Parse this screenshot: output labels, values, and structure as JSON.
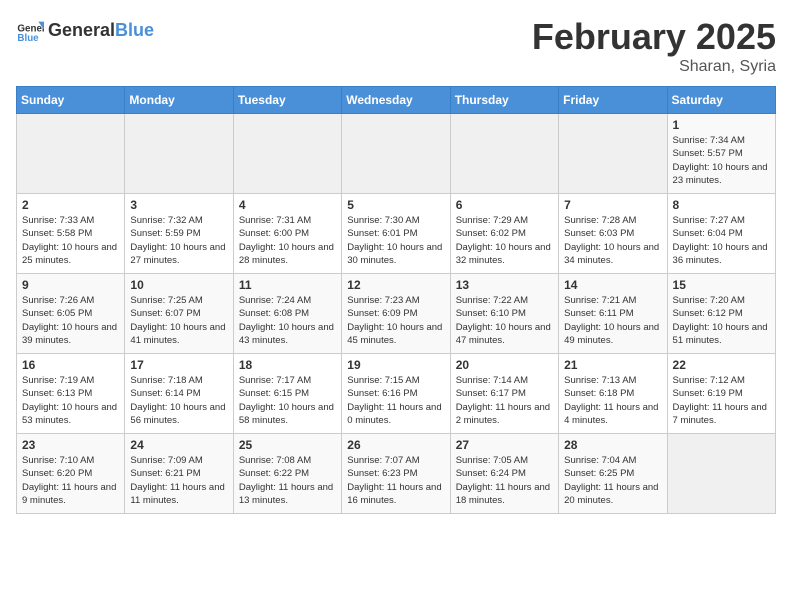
{
  "header": {
    "logo": {
      "text_general": "General",
      "text_blue": "Blue"
    },
    "title": "February 2025",
    "subtitle": "Sharan, Syria"
  },
  "weekdays": [
    "Sunday",
    "Monday",
    "Tuesday",
    "Wednesday",
    "Thursday",
    "Friday",
    "Saturday"
  ],
  "weeks": [
    [
      {
        "day": "",
        "info": ""
      },
      {
        "day": "",
        "info": ""
      },
      {
        "day": "",
        "info": ""
      },
      {
        "day": "",
        "info": ""
      },
      {
        "day": "",
        "info": ""
      },
      {
        "day": "",
        "info": ""
      },
      {
        "day": "1",
        "info": "Sunrise: 7:34 AM\nSunset: 5:57 PM\nDaylight: 10 hours and 23 minutes."
      }
    ],
    [
      {
        "day": "2",
        "info": "Sunrise: 7:33 AM\nSunset: 5:58 PM\nDaylight: 10 hours and 25 minutes."
      },
      {
        "day": "3",
        "info": "Sunrise: 7:32 AM\nSunset: 5:59 PM\nDaylight: 10 hours and 27 minutes."
      },
      {
        "day": "4",
        "info": "Sunrise: 7:31 AM\nSunset: 6:00 PM\nDaylight: 10 hours and 28 minutes."
      },
      {
        "day": "5",
        "info": "Sunrise: 7:30 AM\nSunset: 6:01 PM\nDaylight: 10 hours and 30 minutes."
      },
      {
        "day": "6",
        "info": "Sunrise: 7:29 AM\nSunset: 6:02 PM\nDaylight: 10 hours and 32 minutes."
      },
      {
        "day": "7",
        "info": "Sunrise: 7:28 AM\nSunset: 6:03 PM\nDaylight: 10 hours and 34 minutes."
      },
      {
        "day": "8",
        "info": "Sunrise: 7:27 AM\nSunset: 6:04 PM\nDaylight: 10 hours and 36 minutes."
      }
    ],
    [
      {
        "day": "9",
        "info": "Sunrise: 7:26 AM\nSunset: 6:05 PM\nDaylight: 10 hours and 39 minutes."
      },
      {
        "day": "10",
        "info": "Sunrise: 7:25 AM\nSunset: 6:07 PM\nDaylight: 10 hours and 41 minutes."
      },
      {
        "day": "11",
        "info": "Sunrise: 7:24 AM\nSunset: 6:08 PM\nDaylight: 10 hours and 43 minutes."
      },
      {
        "day": "12",
        "info": "Sunrise: 7:23 AM\nSunset: 6:09 PM\nDaylight: 10 hours and 45 minutes."
      },
      {
        "day": "13",
        "info": "Sunrise: 7:22 AM\nSunset: 6:10 PM\nDaylight: 10 hours and 47 minutes."
      },
      {
        "day": "14",
        "info": "Sunrise: 7:21 AM\nSunset: 6:11 PM\nDaylight: 10 hours and 49 minutes."
      },
      {
        "day": "15",
        "info": "Sunrise: 7:20 AM\nSunset: 6:12 PM\nDaylight: 10 hours and 51 minutes."
      }
    ],
    [
      {
        "day": "16",
        "info": "Sunrise: 7:19 AM\nSunset: 6:13 PM\nDaylight: 10 hours and 53 minutes."
      },
      {
        "day": "17",
        "info": "Sunrise: 7:18 AM\nSunset: 6:14 PM\nDaylight: 10 hours and 56 minutes."
      },
      {
        "day": "18",
        "info": "Sunrise: 7:17 AM\nSunset: 6:15 PM\nDaylight: 10 hours and 58 minutes."
      },
      {
        "day": "19",
        "info": "Sunrise: 7:15 AM\nSunset: 6:16 PM\nDaylight: 11 hours and 0 minutes."
      },
      {
        "day": "20",
        "info": "Sunrise: 7:14 AM\nSunset: 6:17 PM\nDaylight: 11 hours and 2 minutes."
      },
      {
        "day": "21",
        "info": "Sunrise: 7:13 AM\nSunset: 6:18 PM\nDaylight: 11 hours and 4 minutes."
      },
      {
        "day": "22",
        "info": "Sunrise: 7:12 AM\nSunset: 6:19 PM\nDaylight: 11 hours and 7 minutes."
      }
    ],
    [
      {
        "day": "23",
        "info": "Sunrise: 7:10 AM\nSunset: 6:20 PM\nDaylight: 11 hours and 9 minutes."
      },
      {
        "day": "24",
        "info": "Sunrise: 7:09 AM\nSunset: 6:21 PM\nDaylight: 11 hours and 11 minutes."
      },
      {
        "day": "25",
        "info": "Sunrise: 7:08 AM\nSunset: 6:22 PM\nDaylight: 11 hours and 13 minutes."
      },
      {
        "day": "26",
        "info": "Sunrise: 7:07 AM\nSunset: 6:23 PM\nDaylight: 11 hours and 16 minutes."
      },
      {
        "day": "27",
        "info": "Sunrise: 7:05 AM\nSunset: 6:24 PM\nDaylight: 11 hours and 18 minutes."
      },
      {
        "day": "28",
        "info": "Sunrise: 7:04 AM\nSunset: 6:25 PM\nDaylight: 11 hours and 20 minutes."
      },
      {
        "day": "",
        "info": ""
      }
    ]
  ]
}
